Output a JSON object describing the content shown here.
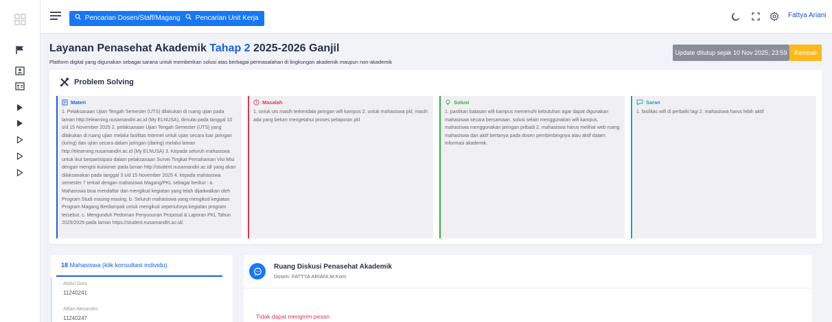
{
  "topbar": {
    "search_dosen_label": "Pencarian Dosen/Staff/Magang",
    "search_unit_label": "Pencarian Unit Kerja",
    "user_name": "Fattya Ariani"
  },
  "page": {
    "title_prefix": "Layanan Penasehat Akademik",
    "title_stage": "Tahap 2",
    "title_suffix": "2025-2026 Ganjil",
    "subtitle": "Platform digital yang digunakan sebagai sarana untuk memberikan solusi atas berbagai permasalahan di lingkungan akademik maupun non-akademik",
    "update_label": "Update ditutup sejak 10 Nov 2025, 23:59",
    "back_label": "Kembali"
  },
  "problem_solving": {
    "title": "Problem Solving",
    "columns": [
      {
        "heading": "Materi",
        "body": "1. Pelaksanaan Ujian Tengah Semester (UTS) dilakukan di ruang ujian pada laman http://elearning.nusamandiri.ac.id (My ELNUSA), dimulai pada tanggal 10 s/d 15 November 2025 2. pelaksanaan Ujian Tengah Semester (UTS) yang dilakukan di ruang ujian melalui fasilitas Internet untuk ujian secara luar jaringan (luring) dan ujian secara dalam jaringan (daring) melalui laman http://elearning.nusamandiri.ac.id (My ELNUSA) 3. Kepada seluruh mahasiswa untuk ikut berpartisipasi dalam pelaksanaan Survei Tingkat Pemahaman Visi Misi dengan mengisi kuisioner pada laman http://student.nusamandiri.ac.id/ yang akan dilaksanakan pada tanggal 3 s/d 15 November 2025 4. kepada mahasiswa semester 7 terkait dengan mahasiswa Magang/PKL sebagai berikut : a. Mahasiswa bisa mendaftar dan mengikuti kegiatan yang telah dijadwalkan oleh Program Studi masing-masing. b. Seluruh mahasiswa yang mengikuti kegiatan Program Magang Berdampak untuk mengikuti sepenuhnya kegiatan program tersebut. c. Mengunduh Pedoman Penyusunan Proposal & Laporan PKL Tahun 2025/2026 pada laman https://student.nusamandiri.ac.id/."
      },
      {
        "heading": "Masalah",
        "body": "1. untuk uts masih terkendala jaringan wifi kampus 2. untuk mahasiswa pkl, masih ada yang belum mengetahui proses pelaporan pkl"
      },
      {
        "heading": "Solusi",
        "body": "1. pastikan batasan wifi kampus memenuhi kebutuhan agar dapat digunakan mahasiswa secara bersamaan. solusi selain menggunakan wifi kampus, mahasiswa menggunakan jaringan pribadi 2. mahasiswa harus melihat web ruang mahasiswa dan aktif bertanya pada dosen pembimbingnya atau aktif dalam informasi akademik."
      },
      {
        "heading": "Saran",
        "body": "1. fasilitas wifi di perbaiki lagi 2. mahasiswa harus lebih aktif"
      }
    ]
  },
  "students": {
    "count": "18",
    "label": "Mahasiswa (klik konsultasi individu)",
    "items": [
      {
        "name": "Abdul Goni",
        "nim": "11240241"
      },
      {
        "name": "Alfian Alexandro",
        "nim": "11240247"
      }
    ]
  },
  "chat": {
    "title": "Ruang Diskusi Penasehat Akademik",
    "dosen": "Dosen: FATTYA ARIANI,M.Kom",
    "error": "Tidak dapat mengirim pesan"
  },
  "colors": {
    "primary": "#1877f2",
    "materi": "#1a5fe0",
    "masalah": "#e0344f",
    "solusi": "#2fae47",
    "saran": "#17a2c7",
    "back_button": "#f8ba1d",
    "update_button": "#898e9a"
  }
}
